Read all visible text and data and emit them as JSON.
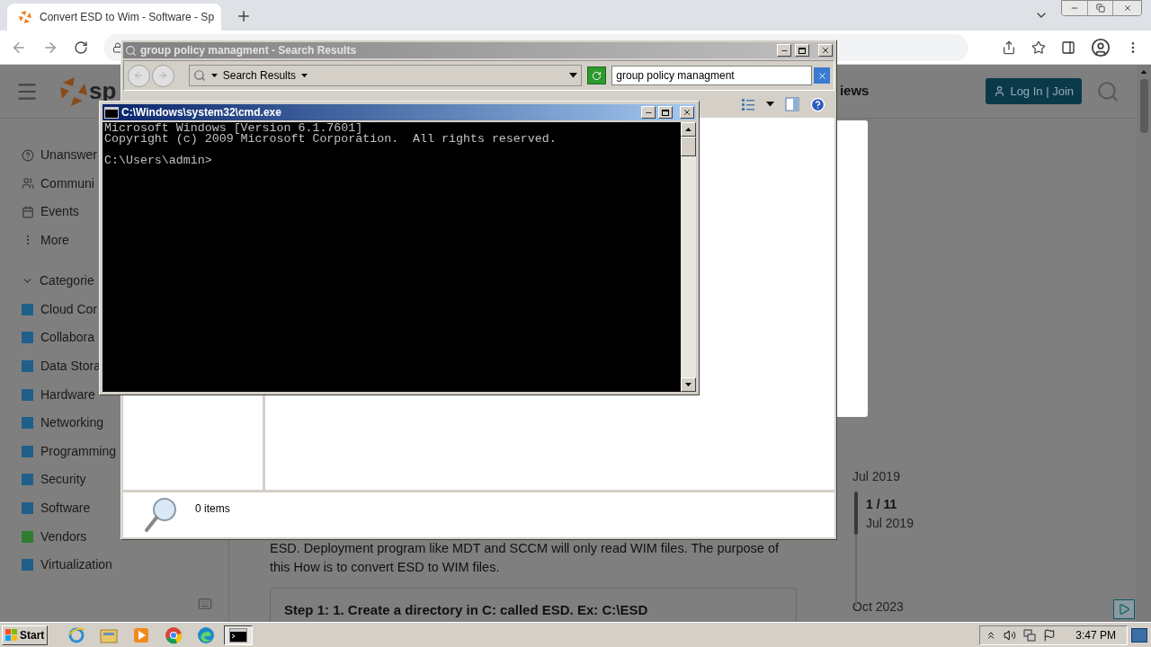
{
  "browser": {
    "tab": {
      "title": "Convert ESD to Wim - Software - Sp"
    }
  },
  "page": {
    "logo_text": "sp",
    "nav_fragment": "iews",
    "login_button": "Log In | Join",
    "sidebar": {
      "items": [
        {
          "label": "Unanswer",
          "kind": "question"
        },
        {
          "label": "Communi",
          "kind": "people"
        },
        {
          "label": "Events",
          "kind": "calendar"
        },
        {
          "label": "More",
          "kind": "dots"
        }
      ],
      "categories_heading": "Categorie",
      "categories": [
        {
          "label": "Cloud Cor",
          "color": "#1f5f8a"
        },
        {
          "label": "Collabora",
          "color": "#1f5f8a"
        },
        {
          "label": "Data Stora",
          "color": "#1f5f8a"
        },
        {
          "label": "Hardware",
          "color": "#1f5f8a"
        },
        {
          "label": "Networking",
          "color": "#1f5f8a"
        },
        {
          "label": "Programming",
          "color": "#1f5f8a"
        },
        {
          "label": "Security",
          "color": "#1f5f8a"
        },
        {
          "label": "Software",
          "color": "#1f5f8a"
        },
        {
          "label": "Vendors",
          "color": "#2e7d32"
        },
        {
          "label": "Virtualization",
          "color": "#1f5f8a"
        }
      ]
    },
    "article": {
      "paragraph": "ESD. Deployment program like MDT and SCCM will only read WIM files. The purpose of",
      "paragraph_2": "this How is to convert ESD to WIM files.",
      "step": "Step 1: 1. Create a directory in C: called ESD. Ex: C:\\ESD"
    },
    "timeline": {
      "start": "Jul 2019",
      "position": "1 / 11",
      "position_date": "Jul 2019",
      "end": "Oct 2023"
    }
  },
  "explorer": {
    "title": "group policy managment - Search Results",
    "breadcrumb": "Search Results",
    "search_value": "group policy managment",
    "status": "0 items"
  },
  "cmd": {
    "title": "C:\\Windows\\system32\\cmd.exe",
    "lines": [
      "Microsoft Windows [Version 6.1.7601]",
      "Copyright (c) 2009 Microsoft Corporation.  All rights reserved."
    ],
    "prompt": "C:\\Users\\admin>"
  },
  "taskbar": {
    "start": "Start",
    "apps": [
      {
        "kind": "ie",
        "active": false
      },
      {
        "kind": "folder",
        "active": false
      },
      {
        "kind": "media",
        "active": false
      },
      {
        "kind": "chrome",
        "active": false
      },
      {
        "kind": "edge",
        "active": false
      },
      {
        "kind": "console",
        "active": true
      }
    ],
    "clock": "3:47 PM"
  }
}
